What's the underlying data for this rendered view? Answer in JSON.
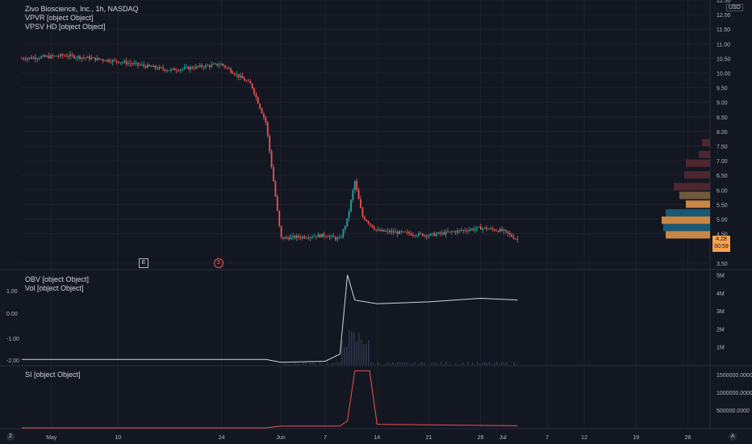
{
  "header": {
    "title": "Zivo Bioscience, Inc., 1h, NASDAQ",
    "ind1": "VPVR [object Object]",
    "ind2": "VPSV HD [object Object]",
    "currency": "USD"
  },
  "panes": {
    "obv_label": "OBV [object Object]",
    "vol_label": "Vol [object Object]",
    "si_label": "SI [object Object]"
  },
  "markers": {
    "earnings": "E",
    "dividend": "$"
  },
  "price_tag": {
    "value": "4.28",
    "countdown": "00:59"
  },
  "bottom": {
    "left_btn": "Z",
    "right_btn": "A"
  },
  "chart_data": [
    {
      "type": "candlestick",
      "title": "Zivo Bioscience, Inc., 1h, NASDAQ",
      "yaxis_ticks": [
        "12.50",
        "12.00",
        "11.50",
        "11.00",
        "10.50",
        "10.00",
        "9.50",
        "9.00",
        "8.50",
        "8.00",
        "7.50",
        "7.00",
        "6.50",
        "6.00",
        "5.50",
        "5.00",
        "4.50",
        "4.28",
        "3.50"
      ],
      "ylim": [
        3.3,
        12.5
      ],
      "xaxis_ticks": [
        "May",
        "10",
        "24",
        "Jun",
        "7",
        "14",
        "21",
        "28",
        "Jul",
        "7",
        "12",
        "19",
        "26"
      ],
      "series": [
        {
          "name": "Price",
          "approx_points": [
            {
              "x": "Apr 27",
              "y": 10.5
            },
            {
              "x": "May 3",
              "y": 10.6
            },
            {
              "x": "May 10",
              "y": 10.4
            },
            {
              "x": "May 17",
              "y": 10.1
            },
            {
              "x": "May 24",
              "y": 10.3
            },
            {
              "x": "May 28",
              "y": 9.6
            },
            {
              "x": "May 30",
              "y": 8.3
            },
            {
              "x": "Jun 1",
              "y": 4.35
            },
            {
              "x": "Jun 7",
              "y": 4.45
            },
            {
              "x": "Jun 9",
              "y": 4.3
            },
            {
              "x": "Jun 10",
              "y": 5.0
            },
            {
              "x": "Jun 11",
              "y": 6.3
            },
            {
              "x": "Jun 12",
              "y": 5.1
            },
            {
              "x": "Jun 14",
              "y": 4.6
            },
            {
              "x": "Jun 21",
              "y": 4.45
            },
            {
              "x": "Jun 28",
              "y": 4.7
            },
            {
              "x": "Jul 1",
              "y": 4.6
            },
            {
              "x": "Jul 3",
              "y": 4.3
            }
          ]
        }
      ],
      "colors": {
        "up": "#26a69a",
        "down": "#ef5350"
      }
    },
    {
      "type": "line",
      "name": "OBV",
      "yaxis_left_ticks": [
        "1.00",
        "0.00",
        "-1.00",
        "-2.00"
      ],
      "yaxis_right_ticks": [
        "5M",
        "4M",
        "3M",
        "2M",
        "1M"
      ],
      "ylim": [
        0,
        5.2
      ],
      "approx_points": [
        {
          "x": "Apr 27",
          "y": 0.3
        },
        {
          "x": "May 30",
          "y": 0.3
        },
        {
          "x": "Jun 1",
          "y": 0.15
        },
        {
          "x": "Jun 7",
          "y": 0.2
        },
        {
          "x": "Jun 9",
          "y": 0.6
        },
        {
          "x": "Jun 10",
          "y": 5.0
        },
        {
          "x": "Jun 11",
          "y": 3.6
        },
        {
          "x": "Jun 14",
          "y": 3.4
        },
        {
          "x": "Jun 21",
          "y": 3.5
        },
        {
          "x": "Jun 28",
          "y": 3.7
        },
        {
          "x": "Jul 3",
          "y": 3.6
        }
      ],
      "color": "#d1d4dc"
    },
    {
      "type": "line",
      "name": "SI",
      "yaxis_ticks": [
        "1500000.0000",
        "1000000.0000",
        "500000.0000"
      ],
      "ylim": [
        0,
        1700000
      ],
      "approx_points": [
        {
          "x": "Apr 27",
          "y": 0
        },
        {
          "x": "May 30",
          "y": 0
        },
        {
          "x": "Jun 1",
          "y": 50000
        },
        {
          "x": "Jun 9",
          "y": 50000
        },
        {
          "x": "Jun 10",
          "y": 200000
        },
        {
          "x": "Jun 11",
          "y": 1600000
        },
        {
          "x": "Jun 13",
          "y": 1600000
        },
        {
          "x": "Jun 14",
          "y": 100000
        },
        {
          "x": "Jul 3",
          "y": 60000
        }
      ],
      "color": "#ef5350"
    }
  ]
}
